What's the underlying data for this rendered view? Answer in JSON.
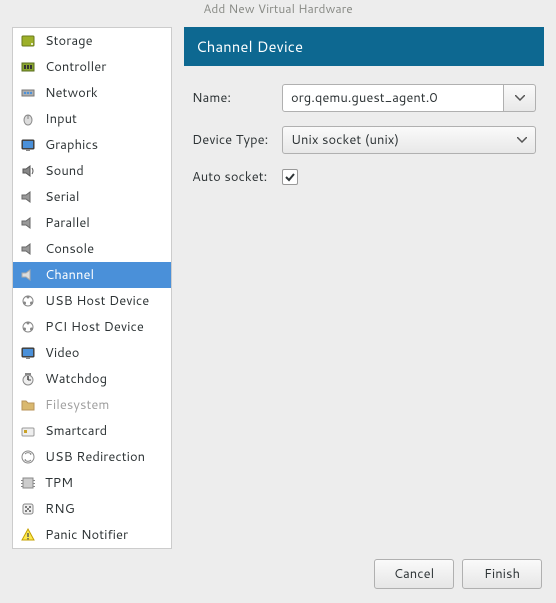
{
  "window": {
    "title": "Add New Virtual Hardware"
  },
  "sidebar": {
    "items": [
      {
        "label": "Storage",
        "icon": "storage-icon"
      },
      {
        "label": "Controller",
        "icon": "controller-icon"
      },
      {
        "label": "Network",
        "icon": "network-icon"
      },
      {
        "label": "Input",
        "icon": "input-icon"
      },
      {
        "label": "Graphics",
        "icon": "graphics-icon"
      },
      {
        "label": "Sound",
        "icon": "sound-icon"
      },
      {
        "label": "Serial",
        "icon": "serial-icon"
      },
      {
        "label": "Parallel",
        "icon": "parallel-icon"
      },
      {
        "label": "Console",
        "icon": "console-icon"
      },
      {
        "label": "Channel",
        "icon": "channel-icon",
        "selected": true
      },
      {
        "label": "USB Host Device",
        "icon": "usb-host-icon"
      },
      {
        "label": "PCI Host Device",
        "icon": "pci-host-icon"
      },
      {
        "label": "Video",
        "icon": "video-icon"
      },
      {
        "label": "Watchdog",
        "icon": "watchdog-icon"
      },
      {
        "label": "Filesystem",
        "icon": "filesystem-icon",
        "disabled": true
      },
      {
        "label": "Smartcard",
        "icon": "smartcard-icon"
      },
      {
        "label": "USB Redirection",
        "icon": "usb-redir-icon"
      },
      {
        "label": "TPM",
        "icon": "tpm-icon"
      },
      {
        "label": "RNG",
        "icon": "rng-icon"
      },
      {
        "label": "Panic Notifier",
        "icon": "panic-icon"
      }
    ]
  },
  "panel": {
    "header": "Channel Device",
    "name_label": "Name:",
    "name_value": "org.qemu.guest_agent.0",
    "device_type_label": "Device Type:",
    "device_type_value": "Unix socket (unix)",
    "auto_socket_label": "Auto socket:",
    "auto_socket_checked": true
  },
  "buttons": {
    "cancel": "Cancel",
    "finish": "Finish"
  }
}
